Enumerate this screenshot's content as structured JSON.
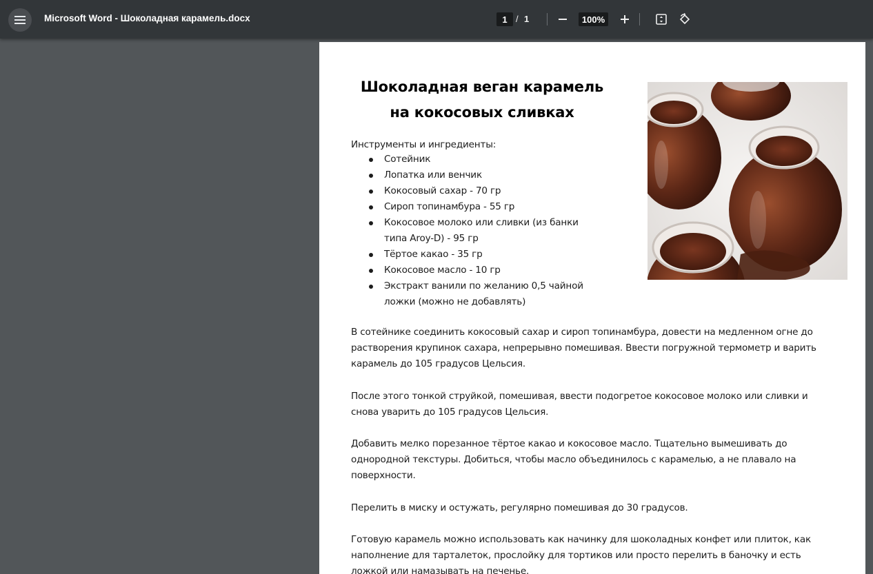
{
  "viewer": {
    "title": "Microsoft Word - Шоколадная карамель.docx",
    "current_page": "1",
    "page_separator": "/",
    "total_pages": "1",
    "zoom": "100%",
    "icons": [
      "menu-icon",
      "zoom-out-icon",
      "zoom-in-icon",
      "fit-page-icon",
      "rotate-icon"
    ]
  },
  "document": {
    "title": "Шоколадная веган карамель на кокосовых сливках",
    "ingredients_heading": "Инструменты и ингредиенты:",
    "ingredients": [
      "Сотейник",
      "Лопатка или венчик",
      "Кокосовый сахар - 70 гр",
      "Сироп топинамбура - 55 гр",
      "Кокосовое молоко или сливки (из банки типа Aroy-D) - 95 гр",
      "Тёртое какао - 35 гр",
      "Кокосовое масло - 10 гр",
      "Экстракт ванили по желанию 0,5 чайной ложки (можно не добавлять)"
    ],
    "paragraphs": [
      "В сотейнике соединить кокосовый сахар и сироп топинамбура, довести на медленном огне до растворения крупинок сахара, непрерывно помешивая. Ввести погружной термометр и варить карамель до 105 градусов Цельсия.",
      "После этого тонкой струйкой, помешивая, ввести подогретое кокосовое молоко или сливки и снова уварить до 105 градусов Цельсия.",
      "Добавить мелко порезанное тёртое какао и кокосовое масло. Тщательно вымешивать до однородной текстуры. Добиться, чтобы масло объединилось с карамелью, а не плавало на поверхности.",
      "Перелить в миску и остужать, регулярно помешивая до 30 градусов.",
      "Готовую карамель можно использовать как начинку для шоколадных конфет или плиток, как наполнение для тарталеток, прослойку для тортиков или просто перелить в баночку и есть ложкой или намазывать на печенье."
    ]
  },
  "colors": {
    "toolbar_bg": "#323639",
    "viewer_bg": "#525659",
    "page_bg": "#ffffff",
    "caramel": "#6a2f1e"
  }
}
